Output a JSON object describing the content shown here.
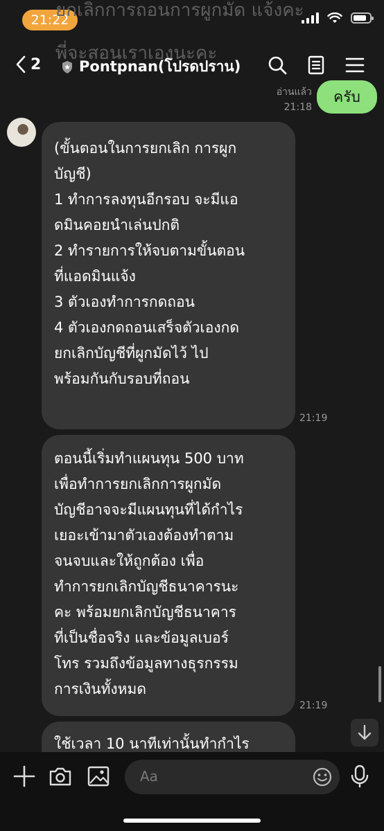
{
  "status_bar": {
    "time": "21:22"
  },
  "ghost_lines": [
    "ยกเลิกการถอนการผูกมัด แจ้งคะ",
    "พี่จะสอนเราเองนะคะ"
  ],
  "header": {
    "back_count": "2",
    "contact_name": "Pontpnan(โปรดปราน)",
    "icons": [
      "chevron-left-icon",
      "shield-icon",
      "search-icon",
      "notes-icon",
      "menu-icon"
    ]
  },
  "messages": {
    "sent": {
      "text": "ครับ",
      "read_label": "อ่านแล้ว",
      "time": "21:18"
    },
    "received": [
      {
        "text": "(ขั้นตอนในการยกเลิก การผูก\nบัญชี)\n1 ทำการลงทุนอีกรอบ จะมีแอ\nดมินคอยนำเล่นปกติ\n2 ทำรายการให้จบตามขั้นตอน\nที่แอดมินแจ้ง\n3 ตัวเองทำการกดถอน\n4 ตัวเองกดถอนเสร็จตัวเองกด\nยกเลิกบัญชีที่ผูกมัดไว้ ไป\nพร้อมกันกับรอบที่ถอน",
        "time": "21:19"
      },
      {
        "text": "ตอนนี้เริ่มทำแผนทุน 500 บาท\nเพื่อทำการยกเลิกการผูกมัด\nบัญชีอาจจะมีแผนทุนที่ได้กำไร\nเยอะเข้ามาตัวเองต้องทำตาม\nจนจบและให้ถูกต้อง เพื่อ\nทำการยกเลิกบัญชีธนาคารนะ\nคะ พร้อมยกเลิกบัญชีธนาคาร\nที่เป็นชื่อจริง และข้อมูลเบอร์\nโทร รวมถึงข้อมูลทางธุรกรรม\nการเงินทั้งหมด",
        "time": "21:19"
      },
      {
        "text": "ใช้เวลา 10 นาทีเท่านั้นทำกำไร"
      }
    ]
  },
  "input": {
    "placeholder": "Aa"
  },
  "colors": {
    "accent": "#f2a53c",
    "sent_bubble": "#8de07c",
    "received_bubble": "#363636",
    "background": "#1a1a1a"
  }
}
